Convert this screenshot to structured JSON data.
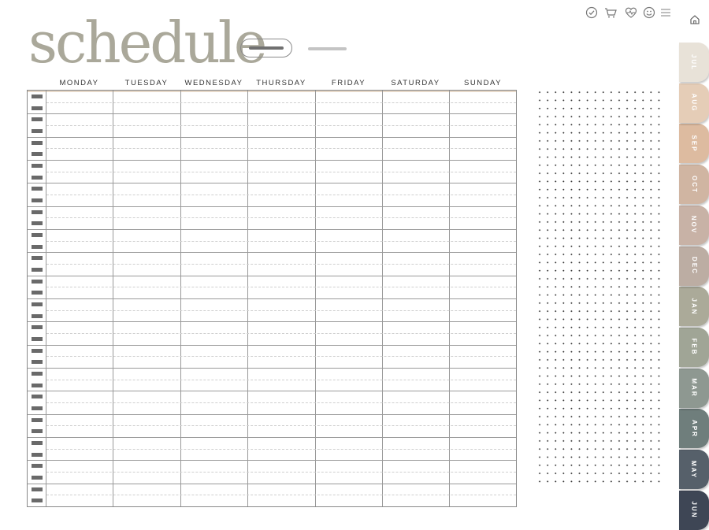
{
  "page": {
    "title": "schedule",
    "days": [
      "MONDAY",
      "TUESDAY",
      "WEDNESDAY",
      "THURSDAY",
      "FRIDAY",
      "SATURDAY",
      "SUNDAY"
    ],
    "time_slot_count": 36
  },
  "top_icons": [
    {
      "name": "check-circle-icon"
    },
    {
      "name": "shopping-cart-icon"
    },
    {
      "name": "heart-pulse-icon"
    },
    {
      "name": "smiley-icon"
    },
    {
      "name": "menu-icon"
    },
    {
      "name": "home-icon"
    }
  ],
  "month_tabs": [
    {
      "label": "JUL",
      "color": "#e8e2d8"
    },
    {
      "label": "AUG",
      "color": "#e5cdb7"
    },
    {
      "label": "SEP",
      "color": "#ddbba0"
    },
    {
      "label": "OCT",
      "color": "#d0b5a2"
    },
    {
      "label": "NOV",
      "color": "#c8b2a6"
    },
    {
      "label": "DEC",
      "color": "#bcada3"
    },
    {
      "label": "JAN",
      "color": "#abaa99"
    },
    {
      "label": "FEB",
      "color": "#a0a596"
    },
    {
      "label": "MAR",
      "color": "#8e9891"
    },
    {
      "label": "APR",
      "color": "#6f7e7c"
    },
    {
      "label": "MAY",
      "color": "#56606a"
    },
    {
      "label": "JUN",
      "color": "#3e4655"
    }
  ]
}
